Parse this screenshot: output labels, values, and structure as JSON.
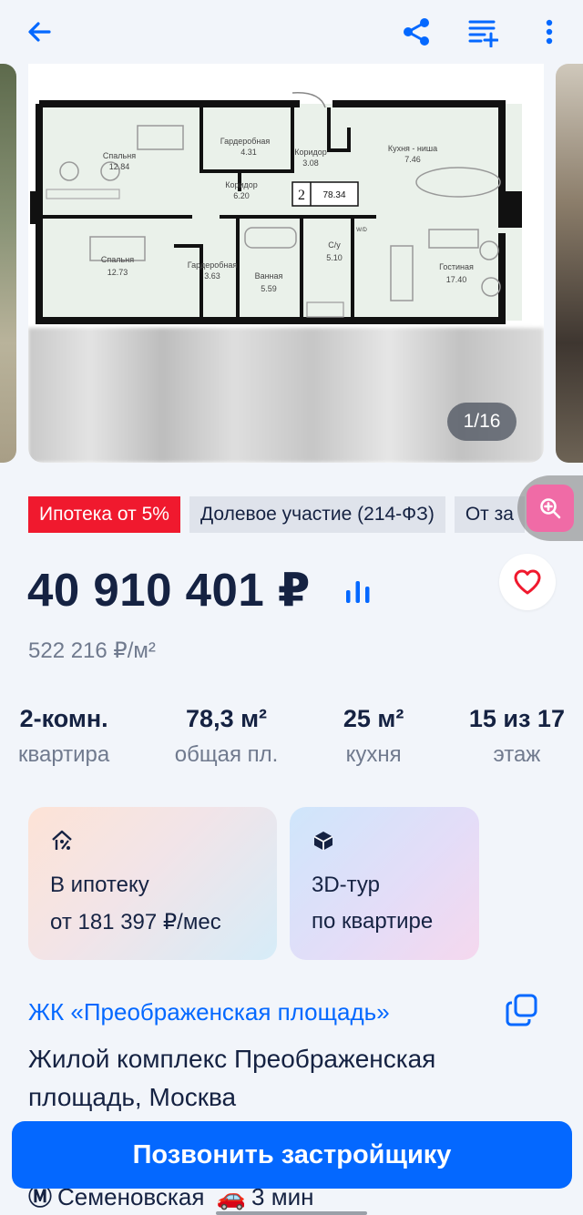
{
  "gallery": {
    "counter": "1/16",
    "plan": {
      "unit_number": "2",
      "unit_area": "78.34",
      "rooms": [
        {
          "name": "Спальня",
          "area": "12.84"
        },
        {
          "name": "Гардеробная",
          "area": "4.31"
        },
        {
          "name": "Коридор",
          "area": "3.08"
        },
        {
          "name": "Кухня - ниша",
          "area": "7.46"
        },
        {
          "name": "Коридор",
          "area": "6.20"
        },
        {
          "name": "Спальня",
          "area": "12.73"
        },
        {
          "name": "Гардеробная",
          "area": "3.63"
        },
        {
          "name": "Ванная",
          "area": "5.59"
        },
        {
          "name": "С/у",
          "area": "5.10"
        },
        {
          "name": "Гостиная",
          "area": "17.40"
        },
        {
          "name": "W/D",
          "area": ""
        }
      ]
    }
  },
  "tags": [
    {
      "label": "Ипотека от 5%",
      "style": "red"
    },
    {
      "label": "Долевое участие (214-ФЗ)",
      "style": "grey"
    },
    {
      "label": "От за",
      "style": "grey"
    }
  ],
  "price": {
    "total": "40 910 401 ₽",
    "per_m2": "522 216 ₽/м²"
  },
  "params": [
    {
      "value": "2-комн.",
      "label": "квартира"
    },
    {
      "value": "78,3 м²",
      "label": "общая пл."
    },
    {
      "value": "25 м²",
      "label": "кухня"
    },
    {
      "value": "15 из 17",
      "label": "этаж"
    }
  ],
  "cards": {
    "mortgage": {
      "line1": "В ипотеку",
      "line2": "от 181 397 ₽/мес",
      "icon": "percent-house-icon"
    },
    "tour": {
      "line1": "3D-тур",
      "line2": "по квартире",
      "icon": "cube-icon"
    }
  },
  "complex": {
    "link": "ЖК «Преображенская площадь»",
    "description": "Жилой комплекс Преображенская площадь, Москва"
  },
  "metro": {
    "station": "Семеновская",
    "time": "3 мин"
  },
  "cta": {
    "label": "Позвонить застройщику"
  },
  "colors": {
    "accent": "#0468ff",
    "tag_red": "#f0192e",
    "text": "#152242",
    "muted": "#707a8e"
  }
}
